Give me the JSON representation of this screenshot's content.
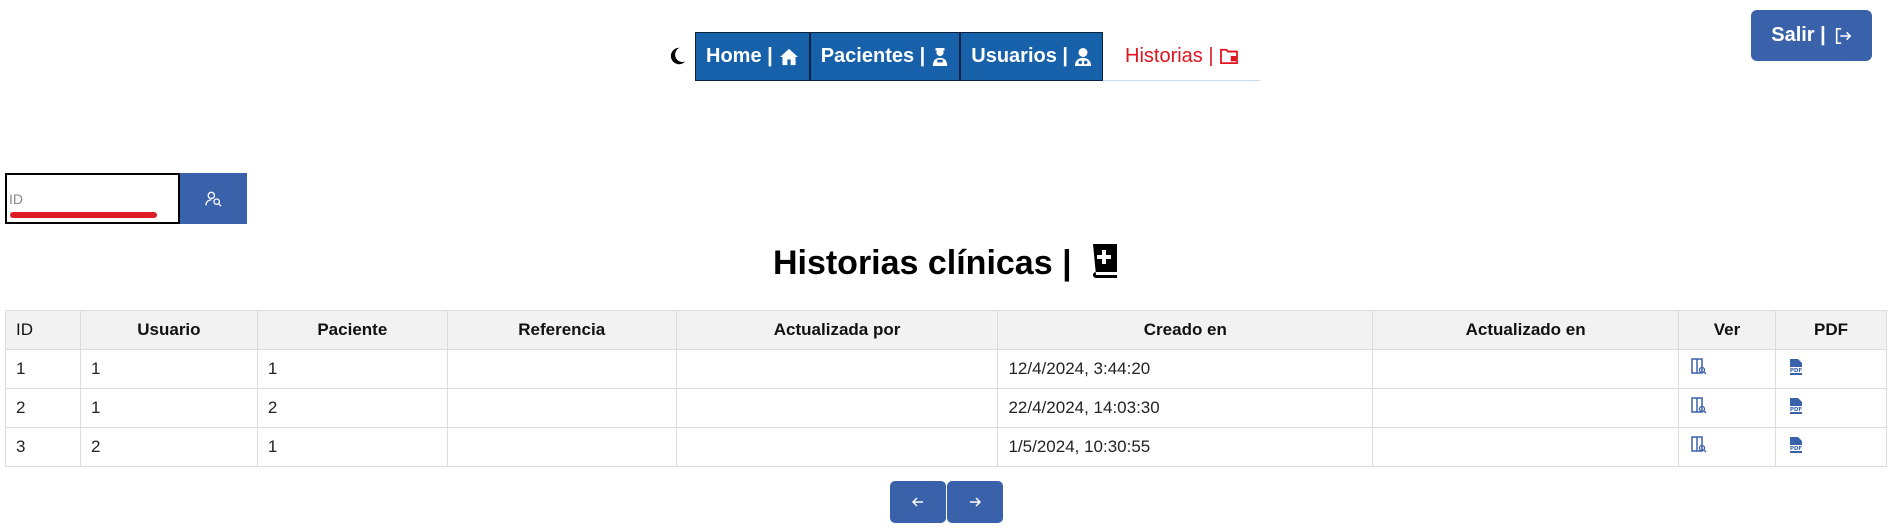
{
  "nav": {
    "theme_icon": "moon-icon",
    "items": [
      {
        "label": "Home |",
        "icon": "home-icon"
      },
      {
        "label": "Pacientes |",
        "icon": "patient-icon"
      },
      {
        "label": "Usuarios |",
        "icon": "doctor-icon"
      },
      {
        "label": "Historias |",
        "icon": "folder-icon",
        "active": true
      }
    ],
    "logout_label": "Salir |",
    "active_color": "#e0141e",
    "accent_color": "#1760aa"
  },
  "search": {
    "placeholder": "ID",
    "value": "",
    "button_icon": "user-search-icon"
  },
  "page": {
    "title": "Historias clínicas |",
    "title_icon": "medical-book-icon"
  },
  "table": {
    "headers": [
      "ID",
      "Usuario",
      "Paciente",
      "Referencia",
      "Actualizada por",
      "Creado en",
      "Actualizado en",
      "Ver",
      "PDF"
    ],
    "rows": [
      {
        "id": "1",
        "usuario": "1",
        "paciente": "1",
        "referencia": "",
        "actualizada_por": "",
        "creado_en": "12/4/2024, 3:44:20",
        "actualizado_en": ""
      },
      {
        "id": "2",
        "usuario": "1",
        "paciente": "2",
        "referencia": "",
        "actualizada_por": "",
        "creado_en": "22/4/2024, 14:03:30",
        "actualizado_en": ""
      },
      {
        "id": "3",
        "usuario": "2",
        "paciente": "1",
        "referencia": "",
        "actualizada_por": "",
        "creado_en": "1/5/2024, 10:30:55",
        "actualizado_en": ""
      }
    ],
    "view_icon": "view-document-icon",
    "pdf_icon": "pdf-file-icon"
  },
  "pagination": {
    "prev_icon": "arrow-left-icon",
    "next_icon": "arrow-right-icon"
  }
}
